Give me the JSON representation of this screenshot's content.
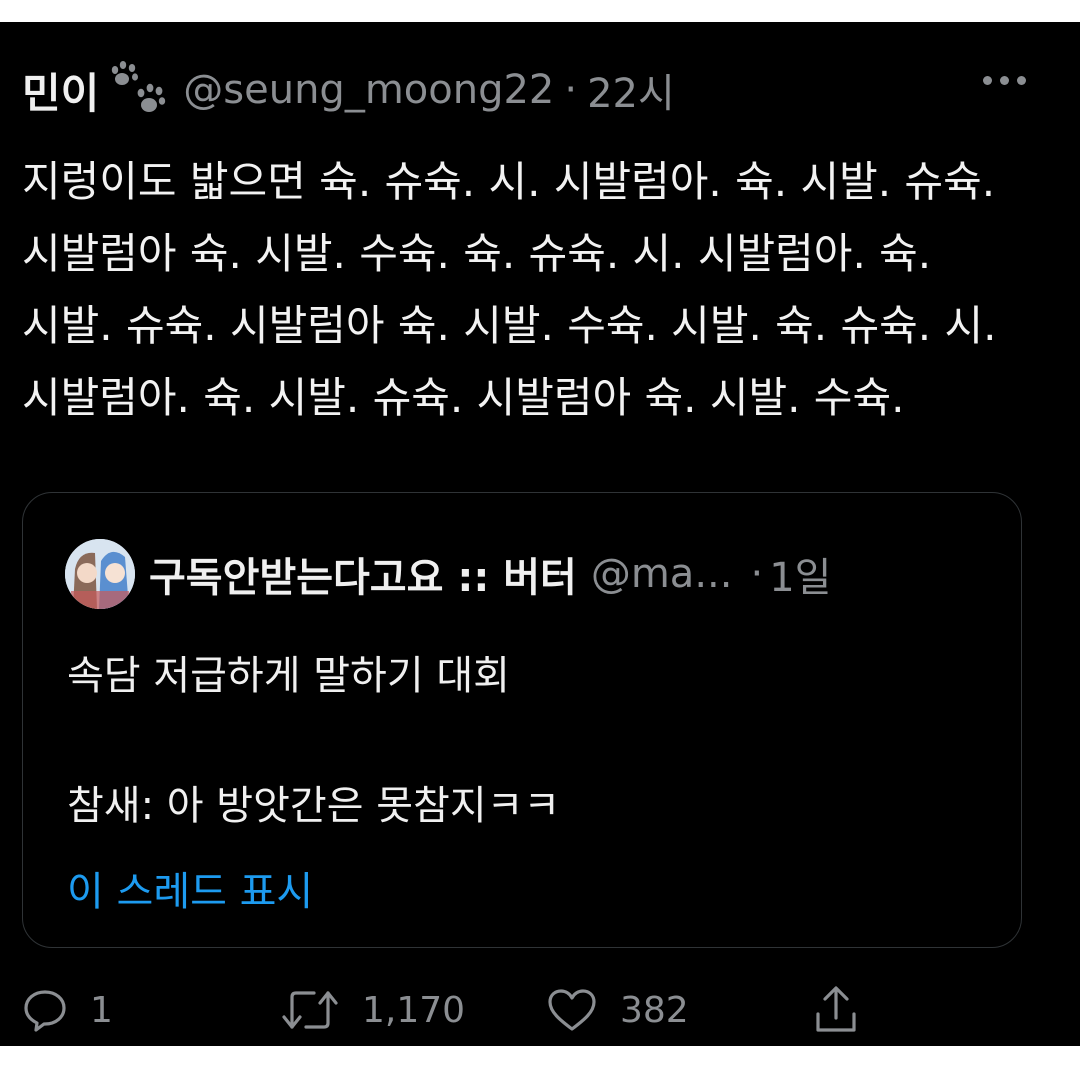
{
  "tweet": {
    "author_name": "민이",
    "handle": "@seung_moong22",
    "separator": "·",
    "time": "22시",
    "text": "지렁이도 밟으면 슉. 슈슉. 시. 시발럼아. 슉. 시발. 슈슉. 시발럼아 슉. 시발. 수슉. 슉. 슈슉. 시. 시발럼아. 슉. 시발. 슈슉. 시발럼아 슉. 시발. 수슉. 시발. 슉. 슈슉. 시. 시발럼아. 슉. 시발. 슈슉. 시발럼아 슉. 시발. 수슉."
  },
  "quote": {
    "author_name": "구독안받는다고요 :: 버터",
    "handle": "@ma...",
    "separator": "·",
    "time": "1일",
    "line1": "속담 저급하게 말하기 대회",
    "line2": "참새: 아 방앗간은 못참지ㅋㅋ",
    "show_thread": "이 스레드 표시"
  },
  "actions": {
    "reply_count": "1",
    "retweet_count": "1,170",
    "like_count": "382"
  },
  "icons": {
    "author_badge": "paw-icon",
    "more": "more-icon",
    "reply": "reply-icon",
    "retweet": "retweet-icon",
    "like": "heart-icon",
    "share": "share-icon"
  },
  "colors": {
    "background": "#000000",
    "text": "#f0f0f0",
    "muted": "#8b8e92",
    "link": "#1d9bf0",
    "card_border": "#2f3336"
  }
}
